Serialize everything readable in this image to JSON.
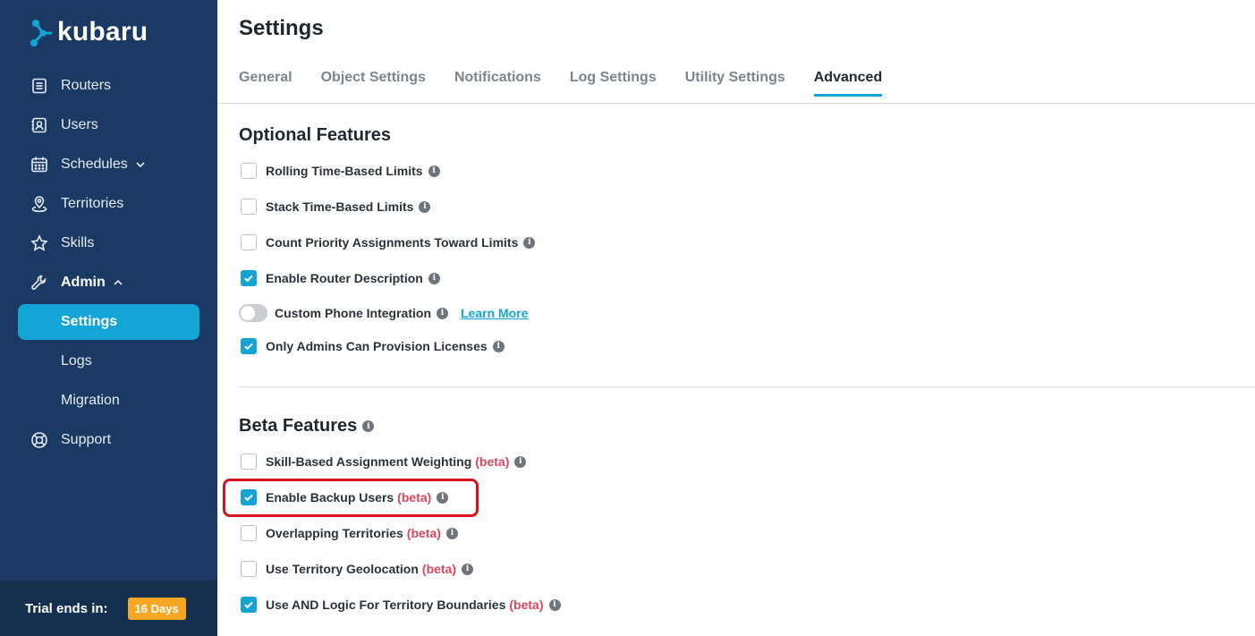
{
  "brand": {
    "name": "kubaru",
    "accent": "#12a5d6",
    "sidebar_bg": "#1b3a63"
  },
  "sidebar": {
    "items": [
      {
        "label": "Routers",
        "icon": "list-icon"
      },
      {
        "label": "Users",
        "icon": "contact-card-icon"
      },
      {
        "label": "Schedules",
        "icon": "calendar-icon",
        "caret": "down"
      },
      {
        "label": "Territories",
        "icon": "map-pin-icon"
      },
      {
        "label": "Skills",
        "icon": "star-icon"
      },
      {
        "label": "Admin",
        "icon": "wrench-icon",
        "caret": "up"
      }
    ],
    "admin_sub": [
      {
        "label": "Settings",
        "active": true
      },
      {
        "label": "Logs"
      },
      {
        "label": "Migration"
      }
    ],
    "support": {
      "label": "Support",
      "icon": "lifebuoy-icon"
    },
    "trial": {
      "text": "Trial ends in:",
      "badge": "16 Days"
    }
  },
  "header": {
    "title": "Settings"
  },
  "tabs": [
    "General",
    "Object Settings",
    "Notifications",
    "Log Settings",
    "Utility Settings",
    "Advanced"
  ],
  "active_tab": "Advanced",
  "optional": {
    "title": "Optional Features",
    "items": [
      {
        "label": "Rolling Time-Based Limits",
        "checked": false
      },
      {
        "label": "Stack Time-Based Limits",
        "checked": false
      },
      {
        "label": "Count Priority Assignments Toward Limits",
        "checked": false
      },
      {
        "label": "Enable Router Description",
        "checked": true
      },
      {
        "label": "Custom Phone Integration",
        "toggle": true,
        "on": false,
        "link": "Learn More"
      },
      {
        "label": "Only Admins Can Provision Licenses",
        "checked": true
      }
    ]
  },
  "beta": {
    "title": "Beta Features",
    "tag": "(beta)",
    "items": [
      {
        "label": "Skill-Based Assignment Weighting",
        "checked": false
      },
      {
        "label": "Enable Backup Users",
        "checked": true,
        "highlighted": true
      },
      {
        "label": "Overlapping Territories",
        "checked": false
      },
      {
        "label": "Use Territory Geolocation",
        "checked": false
      },
      {
        "label": "Use AND Logic For Territory Boundaries",
        "checked": true
      }
    ]
  }
}
